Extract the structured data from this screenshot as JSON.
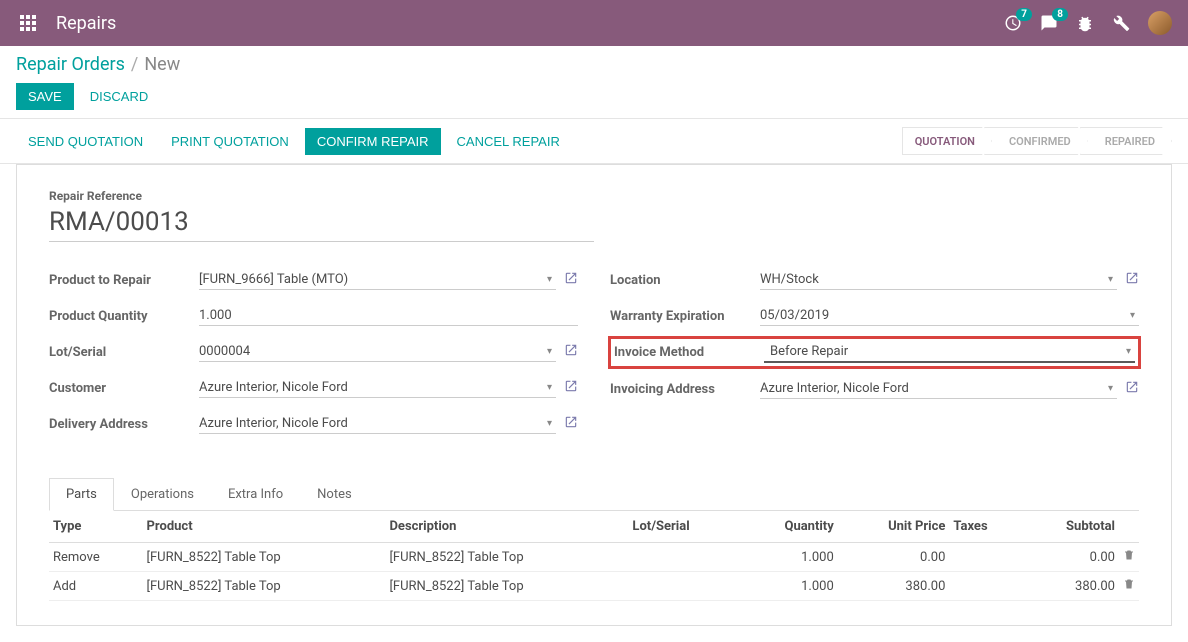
{
  "navbar": {
    "brand": "Repairs",
    "activity_badge": "7",
    "messages_badge": "8"
  },
  "breadcrumb": {
    "root": "Repair Orders",
    "current": "New"
  },
  "buttons": {
    "save": "SAVE",
    "discard": "DISCARD"
  },
  "statusbar": {
    "send_quotation": "SEND QUOTATION",
    "print_quotation": "PRINT QUOTATION",
    "confirm_repair": "CONFIRM REPAIR",
    "cancel_repair": "CANCEL REPAIR",
    "steps": {
      "quotation": "QUOTATION",
      "confirmed": "CONFIRMED",
      "repaired": "REPAIRED"
    }
  },
  "form": {
    "title_label": "Repair Reference",
    "title_value": "RMA/00013",
    "left": {
      "product_label": "Product to Repair",
      "product_value": "[FURN_9666] Table (MTO)",
      "qty_label": "Product Quantity",
      "qty_value": "1.000",
      "lot_label": "Lot/Serial",
      "lot_value": "0000004",
      "customer_label": "Customer",
      "customer_value": "Azure Interior, Nicole Ford",
      "delivery_label": "Delivery Address",
      "delivery_value": "Azure Interior, Nicole Ford"
    },
    "right": {
      "location_label": "Location",
      "location_value": "WH/Stock",
      "warranty_label": "Warranty Expiration",
      "warranty_value": "05/03/2019",
      "invoice_method_label": "Invoice Method",
      "invoice_method_value": "Before Repair",
      "invoicing_address_label": "Invoicing Address",
      "invoicing_address_value": "Azure Interior, Nicole Ford"
    }
  },
  "tabs": {
    "parts": "Parts",
    "operations": "Operations",
    "extra_info": "Extra Info",
    "notes": "Notes"
  },
  "table": {
    "headers": {
      "type": "Type",
      "product": "Product",
      "description": "Description",
      "lot_serial": "Lot/Serial",
      "quantity": "Quantity",
      "unit_price": "Unit Price",
      "taxes": "Taxes",
      "subtotal": "Subtotal"
    },
    "rows": [
      {
        "type": "Remove",
        "product": "[FURN_8522] Table Top",
        "description": "[FURN_8522] Table Top",
        "lot_serial": "",
        "quantity": "1.000",
        "unit_price": "0.00",
        "taxes": "",
        "subtotal": "0.00"
      },
      {
        "type": "Add",
        "product": "[FURN_8522] Table Top",
        "description": "[FURN_8522] Table Top",
        "lot_serial": "",
        "quantity": "1.000",
        "unit_price": "380.00",
        "taxes": "",
        "subtotal": "380.00"
      }
    ]
  }
}
